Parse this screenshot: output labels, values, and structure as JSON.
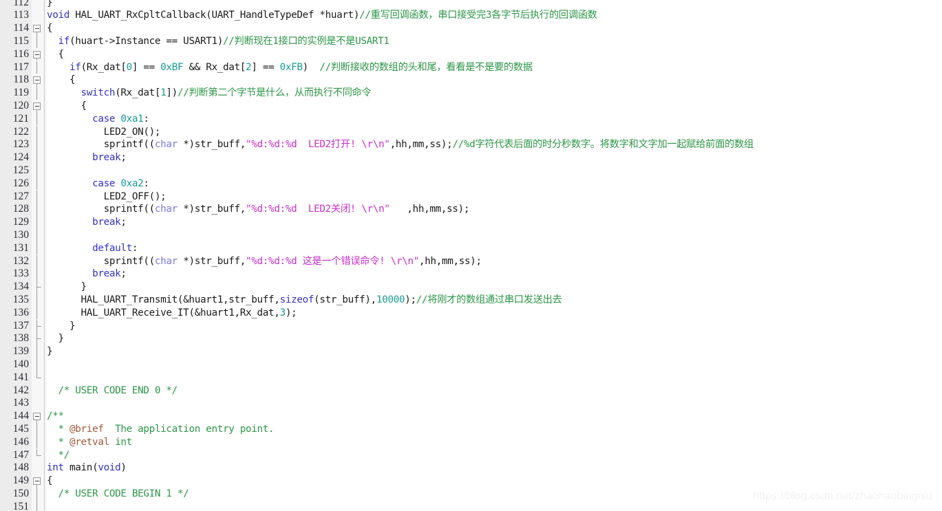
{
  "editor": {
    "first_line": 112,
    "last_line": 151,
    "language": "C",
    "colors": {
      "background": "#ffffff",
      "gutter_background": "#ececec",
      "fold_column_background": "#f7f7f7",
      "gutter_separator": "#c8c8c8",
      "line_number": "#2b2b35",
      "plain_text": "#1a1a1a",
      "keyword": "#3232c8",
      "comment": "#2e9648",
      "string": "#c832c8",
      "number": "#1a9a96",
      "type": "#7a7ae6",
      "doc_tag": "#a05a3c",
      "watermark": "#f2f2f2"
    }
  },
  "watermark": {
    "text": "https://blog.csdn.net/zhaohaobingniu"
  },
  "lines": [
    {
      "n": 112,
      "fold": "none",
      "tokens": [
        {
          "t": "}",
          "c": "pln"
        }
      ]
    },
    {
      "n": 113,
      "fold": "none",
      "tokens": [
        {
          "t": "void",
          "c": "kw"
        },
        {
          "t": " HAL_UART_RxCpltCallback(UART_HandleTypeDef *huart)",
          "c": "pln"
        },
        {
          "t": "//重写回调函数，串口接受完3各字节后执行的回调函数",
          "c": "cmt"
        }
      ]
    },
    {
      "n": 114,
      "fold": "box",
      "tokens": [
        {
          "t": "{",
          "c": "pln"
        }
      ]
    },
    {
      "n": 115,
      "fold": "line",
      "tokens": [
        {
          "t": "  ",
          "c": "pln"
        },
        {
          "t": "if",
          "c": "kw"
        },
        {
          "t": "(huart->Instance == USART1)",
          "c": "pln"
        },
        {
          "t": "//判断现在1接口的实例是不是USART1",
          "c": "cmt"
        }
      ]
    },
    {
      "n": 116,
      "fold": "box",
      "tokens": [
        {
          "t": "  {",
          "c": "pln"
        }
      ]
    },
    {
      "n": 117,
      "fold": "line",
      "tokens": [
        {
          "t": "    ",
          "c": "pln"
        },
        {
          "t": "if",
          "c": "kw"
        },
        {
          "t": "(Rx_dat[",
          "c": "pln"
        },
        {
          "t": "0",
          "c": "num"
        },
        {
          "t": "] == ",
          "c": "pln"
        },
        {
          "t": "0xBF",
          "c": "num"
        },
        {
          "t": " && Rx_dat[",
          "c": "pln"
        },
        {
          "t": "2",
          "c": "num"
        },
        {
          "t": "] == ",
          "c": "pln"
        },
        {
          "t": "0xFB",
          "c": "num"
        },
        {
          "t": ")  ",
          "c": "pln"
        },
        {
          "t": "//判断接收的数组的头和尾，看看是不是要的数据",
          "c": "cmt"
        }
      ]
    },
    {
      "n": 118,
      "fold": "box",
      "tokens": [
        {
          "t": "    {",
          "c": "pln"
        }
      ]
    },
    {
      "n": 119,
      "fold": "line",
      "tokens": [
        {
          "t": "      ",
          "c": "pln"
        },
        {
          "t": "switch",
          "c": "kw"
        },
        {
          "t": "(Rx_dat[",
          "c": "pln"
        },
        {
          "t": "1",
          "c": "num"
        },
        {
          "t": "])",
          "c": "pln"
        },
        {
          "t": "//判断第二个字节是什么，从而执行不同命令",
          "c": "cmt"
        }
      ]
    },
    {
      "n": 120,
      "fold": "box",
      "tokens": [
        {
          "t": "      {",
          "c": "pln"
        }
      ]
    },
    {
      "n": 121,
      "fold": "line",
      "tokens": [
        {
          "t": "        ",
          "c": "pln"
        },
        {
          "t": "case",
          "c": "kw"
        },
        {
          "t": " ",
          "c": "pln"
        },
        {
          "t": "0xa1",
          "c": "num"
        },
        {
          "t": ":",
          "c": "pln"
        }
      ]
    },
    {
      "n": 122,
      "fold": "line",
      "tokens": [
        {
          "t": "          LED2_ON();",
          "c": "pln"
        }
      ]
    },
    {
      "n": 123,
      "fold": "line",
      "tokens": [
        {
          "t": "          sprintf((",
          "c": "pln"
        },
        {
          "t": "char",
          "c": "type"
        },
        {
          "t": " *)str_buff,",
          "c": "pln"
        },
        {
          "t": "\"%d:%d:%d  LED2打开! \\r\\n\"",
          "c": "str"
        },
        {
          "t": ",hh,mm,ss);",
          "c": "pln"
        },
        {
          "t": "//%d字符代表后面的时分秒数字。将数字和文字加一起赋给前面的数组",
          "c": "cmt"
        }
      ]
    },
    {
      "n": 124,
      "fold": "line",
      "tokens": [
        {
          "t": "        ",
          "c": "pln"
        },
        {
          "t": "break",
          "c": "kw"
        },
        {
          "t": ";",
          "c": "pln"
        }
      ]
    },
    {
      "n": 125,
      "fold": "line",
      "tokens": []
    },
    {
      "n": 126,
      "fold": "line",
      "tokens": [
        {
          "t": "        ",
          "c": "pln"
        },
        {
          "t": "case",
          "c": "kw"
        },
        {
          "t": " ",
          "c": "pln"
        },
        {
          "t": "0xa2",
          "c": "num"
        },
        {
          "t": ":",
          "c": "pln"
        }
      ]
    },
    {
      "n": 127,
      "fold": "line",
      "tokens": [
        {
          "t": "          LED2_OFF();",
          "c": "pln"
        }
      ]
    },
    {
      "n": 128,
      "fold": "line",
      "tokens": [
        {
          "t": "          sprintf((",
          "c": "pln"
        },
        {
          "t": "char",
          "c": "type"
        },
        {
          "t": " *)str_buff,",
          "c": "pln"
        },
        {
          "t": "\"%d:%d:%d  LED2关闭! \\r\\n\"",
          "c": "str"
        },
        {
          "t": "   ,hh,mm,ss);",
          "c": "pln"
        }
      ]
    },
    {
      "n": 129,
      "fold": "line",
      "tokens": [
        {
          "t": "        ",
          "c": "pln"
        },
        {
          "t": "break",
          "c": "kw"
        },
        {
          "t": ";",
          "c": "pln"
        }
      ]
    },
    {
      "n": 130,
      "fold": "line",
      "tokens": []
    },
    {
      "n": 131,
      "fold": "line",
      "tokens": [
        {
          "t": "        ",
          "c": "pln"
        },
        {
          "t": "default",
          "c": "kw"
        },
        {
          "t": ":",
          "c": "pln"
        }
      ]
    },
    {
      "n": 132,
      "fold": "line",
      "tokens": [
        {
          "t": "          sprintf((",
          "c": "pln"
        },
        {
          "t": "char",
          "c": "type"
        },
        {
          "t": " *)str_buff,",
          "c": "pln"
        },
        {
          "t": "\"%d:%d:%d 这是一个错误命令! \\r\\n\"",
          "c": "str"
        },
        {
          "t": ",hh,mm,ss);",
          "c": "pln"
        }
      ]
    },
    {
      "n": 133,
      "fold": "line",
      "tokens": [
        {
          "t": "        ",
          "c": "pln"
        },
        {
          "t": "break",
          "c": "kw"
        },
        {
          "t": ";",
          "c": "pln"
        }
      ]
    },
    {
      "n": 134,
      "fold": "tick",
      "tokens": [
        {
          "t": "      }",
          "c": "pln"
        }
      ]
    },
    {
      "n": 135,
      "fold": "line",
      "tokens": [
        {
          "t": "      HAL_UART_Transmit(&huart1,str_buff,",
          "c": "pln"
        },
        {
          "t": "sizeof",
          "c": "kw"
        },
        {
          "t": "(str_buff),",
          "c": "pln"
        },
        {
          "t": "10000",
          "c": "num"
        },
        {
          "t": ");",
          "c": "pln"
        },
        {
          "t": "//将刚才的数组通过串口发送出去",
          "c": "cmt"
        }
      ]
    },
    {
      "n": 136,
      "fold": "line",
      "tokens": [
        {
          "t": "      HAL_UART_Receive_IT(&huart1,Rx_dat,",
          "c": "pln"
        },
        {
          "t": "3",
          "c": "num"
        },
        {
          "t": ");",
          "c": "pln"
        }
      ]
    },
    {
      "n": 137,
      "fold": "tick",
      "tokens": [
        {
          "t": "    }",
          "c": "pln"
        }
      ]
    },
    {
      "n": 138,
      "fold": "tick",
      "tokens": [
        {
          "t": "  }",
          "c": "pln"
        }
      ]
    },
    {
      "n": 139,
      "fold": "line",
      "tokens": [
        {
          "t": "}",
          "c": "pln"
        }
      ]
    },
    {
      "n": 140,
      "fold": "line",
      "tokens": []
    },
    {
      "n": 141,
      "fold": "end",
      "tokens": []
    },
    {
      "n": 142,
      "fold": "none",
      "tokens": [
        {
          "t": "  /* USER CODE END 0 */",
          "c": "cmt"
        }
      ]
    },
    {
      "n": 143,
      "fold": "none",
      "tokens": []
    },
    {
      "n": 144,
      "fold": "box",
      "tokens": [
        {
          "t": "/**",
          "c": "cmt"
        }
      ]
    },
    {
      "n": 145,
      "fold": "line",
      "tokens": [
        {
          "t": "  * ",
          "c": "cmt"
        },
        {
          "t": "@brief",
          "c": "doc"
        },
        {
          "t": "  The application entry point.",
          "c": "cmt"
        }
      ]
    },
    {
      "n": 146,
      "fold": "line",
      "tokens": [
        {
          "t": "  * ",
          "c": "cmt"
        },
        {
          "t": "@retval",
          "c": "doc"
        },
        {
          "t": " int",
          "c": "cmt"
        }
      ]
    },
    {
      "n": 147,
      "fold": "end",
      "tokens": [
        {
          "t": "  */",
          "c": "cmt"
        }
      ]
    },
    {
      "n": 148,
      "fold": "none",
      "tokens": [
        {
          "t": "int",
          "c": "kw"
        },
        {
          "t": " main(",
          "c": "pln"
        },
        {
          "t": "void",
          "c": "kw"
        },
        {
          "t": ")",
          "c": "pln"
        }
      ]
    },
    {
      "n": 149,
      "fold": "box",
      "tokens": [
        {
          "t": "{",
          "c": "pln"
        }
      ]
    },
    {
      "n": 150,
      "fold": "line",
      "tokens": [
        {
          "t": "  /* USER CODE BEGIN 1 */",
          "c": "cmt"
        }
      ]
    },
    {
      "n": 151,
      "fold": "line",
      "tokens": []
    }
  ]
}
